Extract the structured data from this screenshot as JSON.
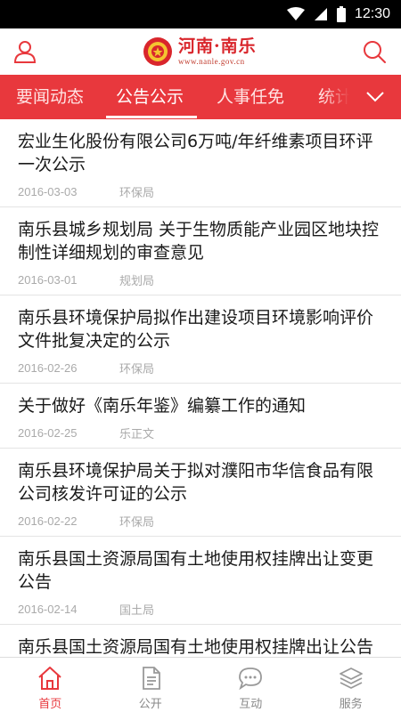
{
  "statusbar": {
    "time": "12:30"
  },
  "header": {
    "logo_title": "河南·南乐",
    "logo_url": "www.nanle.gov.cn"
  },
  "colors": {
    "brand_red": "#e8383d",
    "meta_gray": "#aaaaaa"
  },
  "tabs": [
    {
      "label": "要闻动态",
      "active": false
    },
    {
      "label": "公告公示",
      "active": true
    },
    {
      "label": "人事任免",
      "active": false
    },
    {
      "label": "统计",
      "active": false
    }
  ],
  "articles": [
    {
      "title": "宏业生化股份有限公司6万吨/年纤维素项目环评一次公示",
      "date": "2016-03-03",
      "source": "环保局"
    },
    {
      "title": "南乐县城乡规划局 关于生物质能产业园区地块控制性详细规划的审查意见",
      "date": "2016-03-01",
      "source": "规划局"
    },
    {
      "title": "南乐县环境保护局拟作出建设项目环境影响评价文件批复决定的公示",
      "date": "2016-02-26",
      "source": "环保局"
    },
    {
      "title": "关于做好《南乐年鉴》编纂工作的通知",
      "date": "2016-02-25",
      "source": "乐正文"
    },
    {
      "title": "南乐县环境保护局关于拟对濮阳市华信食品有限公司核发许可证的公示",
      "date": "2016-02-22",
      "source": "环保局"
    },
    {
      "title": "南乐县国土资源局国有土地使用权挂牌出让变更公告",
      "date": "2016-02-14",
      "source": "国土局"
    },
    {
      "title": "南乐县国土资源局国有土地使用权挂牌出让公告",
      "date": "",
      "source": ""
    }
  ],
  "bottom_nav": [
    {
      "label": "首页",
      "icon": "home-icon",
      "active": true
    },
    {
      "label": "公开",
      "icon": "document-icon",
      "active": false
    },
    {
      "label": "互动",
      "icon": "chat-icon",
      "active": false
    },
    {
      "label": "服务",
      "icon": "layers-icon",
      "active": false
    }
  ]
}
